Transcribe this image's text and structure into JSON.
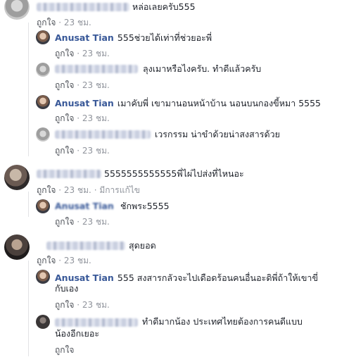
{
  "comments": [
    {
      "id": "c1",
      "author": "",
      "text": "หล่อเลยครับ555",
      "like": "ถูกใจ",
      "time": "23 ชม.",
      "edited": ""
    },
    {
      "id": "r1",
      "author": "Anusat Tian",
      "text": "555ช่วยได้เท่าที่ช่วยอะพี่",
      "like": "ถูกใจ",
      "time": "23 ชม."
    },
    {
      "id": "r2",
      "author": "",
      "text": "ลุงเมาหรือไงครับ. ทำดีแล้วครับ",
      "like": "ถูกใจ",
      "time": "23 ชม."
    },
    {
      "id": "r3",
      "author": "Anusat Tian",
      "text": "เมาคับพี่ เขามานอนหน้าบ้าน นอนบนกองขี้หมา 5555",
      "like": "ถูกใจ",
      "time": "23 ชม."
    },
    {
      "id": "r4",
      "author": "",
      "text": "เวรกรรม น่าขำด้วยน่าสงสารด้วย",
      "like": "ถูกใจ",
      "time": "23 ชม."
    },
    {
      "id": "c2",
      "author": "",
      "text": "5555555555555พี่ไผ่ไปส่งที่ไหนอะ",
      "like": "ถูกใจ",
      "time": "23 ชม.",
      "edited": "มีการแก้ไข"
    },
    {
      "id": "r5",
      "author": "Anusat Tian",
      "text": "ชักพระ5555",
      "like": "ถูกใจ",
      "time": "23 ชม."
    },
    {
      "id": "c3",
      "author": "",
      "text": "สุดยอด",
      "like": "ถูกใจ",
      "time": "23 ชม."
    },
    {
      "id": "r6",
      "author": "Anusat Tian",
      "text_line1": "555 สงสารกลัวจะไปเดือดร้อนคนอื่นอะดิพี่ถ้าให้เขาขี่",
      "text_line2": "กับเอง",
      "like": "ถูกใจ",
      "time": "23 ชม."
    },
    {
      "id": "r7",
      "author": "",
      "text_line1": "ทำดีมากน้อง ประเทศไทยต้องการคนดีแบบ",
      "text_line2": "น้องอีกเยอะ",
      "like": "ถูกใจ",
      "time": ""
    }
  ],
  "separator": "·"
}
